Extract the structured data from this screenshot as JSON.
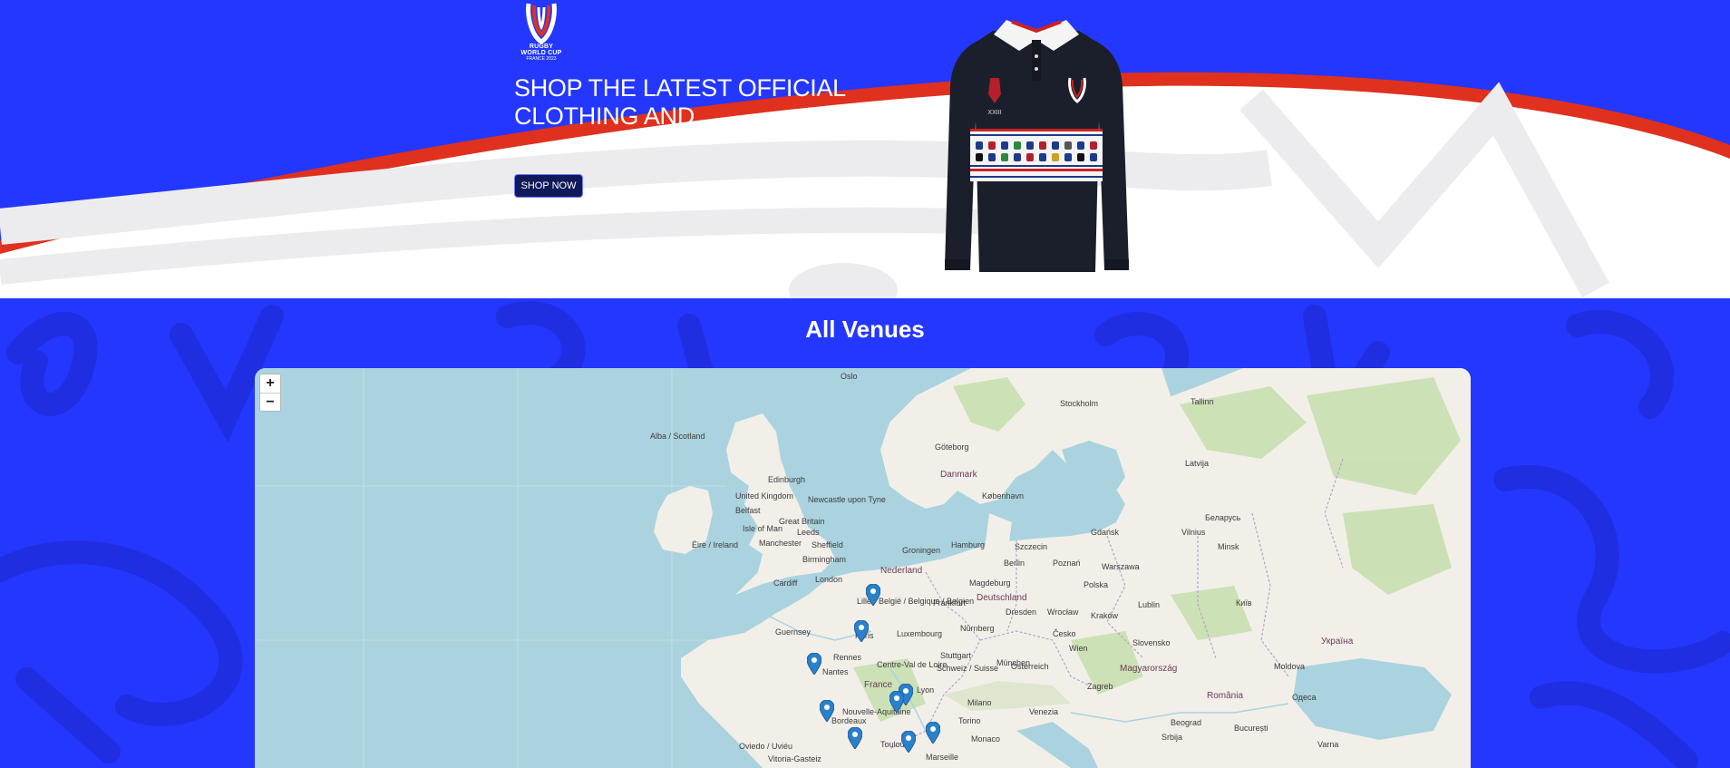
{
  "hero": {
    "logo": {
      "line1": "RUGBY",
      "line2": "WORLD CUP",
      "line3": "FRANCE 2023"
    },
    "title": "SHOP THE LATEST OFFICIAL CLOTHING AND MERCHANDISE",
    "button_label": "SHOP NOW",
    "shirt_crest_text": "XXIII"
  },
  "venues": {
    "title": "All Venues",
    "map": {
      "zoom_in_label": "+",
      "zoom_out_label": "−",
      "place_labels": [
        {
          "text": "Oslo",
          "cls": ""
        },
        {
          "text": "Stockholm",
          "cls": ""
        },
        {
          "text": "Tallinn",
          "cls": ""
        },
        {
          "text": "Alba / Scotland",
          "cls": ""
        },
        {
          "text": "Göteborg",
          "cls": ""
        },
        {
          "text": "Latvija",
          "cls": ""
        },
        {
          "text": "Danmark",
          "cls": "big"
        },
        {
          "text": "Edinburgh",
          "cls": ""
        },
        {
          "text": "United Kingdom",
          "cls": ""
        },
        {
          "text": "Newcastle upon Tyne",
          "cls": ""
        },
        {
          "text": "København",
          "cls": ""
        },
        {
          "text": "Belfast",
          "cls": ""
        },
        {
          "text": "Great Britain",
          "cls": ""
        },
        {
          "text": "Isle of Man",
          "cls": ""
        },
        {
          "text": "Leeds",
          "cls": ""
        },
        {
          "text": "Éire / Ireland",
          "cls": ""
        },
        {
          "text": "Manchester",
          "cls": ""
        },
        {
          "text": "Sheffield",
          "cls": ""
        },
        {
          "text": "Hamburg",
          "cls": ""
        },
        {
          "text": "Szczecin",
          "cls": ""
        },
        {
          "text": "Gdańsk",
          "cls": ""
        },
        {
          "text": "Vilnius",
          "cls": ""
        },
        {
          "text": "Birmingham",
          "cls": ""
        },
        {
          "text": "Groningen",
          "cls": ""
        },
        {
          "text": "Berlin",
          "cls": ""
        },
        {
          "text": "Poznań",
          "cls": ""
        },
        {
          "text": "Warszawa",
          "cls": ""
        },
        {
          "text": "Minsk",
          "cls": ""
        },
        {
          "text": "Беларусь",
          "cls": ""
        },
        {
          "text": "Cardiff",
          "cls": ""
        },
        {
          "text": "London",
          "cls": ""
        },
        {
          "text": "Nederland",
          "cls": "big"
        },
        {
          "text": "Magdeburg",
          "cls": ""
        },
        {
          "text": "Polska",
          "cls": ""
        },
        {
          "text": "Lille",
          "cls": ""
        },
        {
          "text": "België / Belgique / Belgien",
          "cls": ""
        },
        {
          "text": "Frankfurt",
          "cls": ""
        },
        {
          "text": "Deutschland",
          "cls": "big"
        },
        {
          "text": "Dresden",
          "cls": ""
        },
        {
          "text": "Wrocław",
          "cls": ""
        },
        {
          "text": "Kraków",
          "cls": ""
        },
        {
          "text": "Lublin",
          "cls": ""
        },
        {
          "text": "Київ",
          "cls": ""
        },
        {
          "text": "Guernsey",
          "cls": ""
        },
        {
          "text": "Paris",
          "cls": ""
        },
        {
          "text": "Luxembourg",
          "cls": ""
        },
        {
          "text": "Nürnberg",
          "cls": ""
        },
        {
          "text": "Česko",
          "cls": ""
        },
        {
          "text": "Slovensko",
          "cls": ""
        },
        {
          "text": "Україна",
          "cls": "big"
        },
        {
          "text": "Rennes",
          "cls": ""
        },
        {
          "text": "Stuttgart",
          "cls": ""
        },
        {
          "text": "München",
          "cls": ""
        },
        {
          "text": "Wien",
          "cls": ""
        },
        {
          "text": "Nantes",
          "cls": ""
        },
        {
          "text": "Centre-Val de Loire",
          "cls": ""
        },
        {
          "text": "Schweiz / Suisse",
          "cls": ""
        },
        {
          "text": "Österreich",
          "cls": ""
        },
        {
          "text": "Magyarország",
          "cls": "big"
        },
        {
          "text": "Moldova",
          "cls": ""
        },
        {
          "text": "France",
          "cls": "big"
        },
        {
          "text": "Lyon",
          "cls": ""
        },
        {
          "text": "Milano",
          "cls": ""
        },
        {
          "text": "Venezia",
          "cls": ""
        },
        {
          "text": "Zagreb",
          "cls": ""
        },
        {
          "text": "România",
          "cls": "big"
        },
        {
          "text": "Одеса",
          "cls": ""
        },
        {
          "text": "Nouvelle-Aquitaine",
          "cls": ""
        },
        {
          "text": "Bordeaux",
          "cls": ""
        },
        {
          "text": "Torino",
          "cls": ""
        },
        {
          "text": "Beograd",
          "cls": ""
        },
        {
          "text": "București",
          "cls": ""
        },
        {
          "text": "Toulouse",
          "cls": ""
        },
        {
          "text": "Marseille",
          "cls": ""
        },
        {
          "text": "Monaco",
          "cls": ""
        },
        {
          "text": "Srbija",
          "cls": ""
        },
        {
          "text": "Varna",
          "cls": ""
        },
        {
          "text": "Oviedo / Uviéu",
          "cls": ""
        },
        {
          "text": "Vitoria-Gasteiz",
          "cls": ""
        }
      ],
      "markers": [
        "Lille",
        "Paris",
        "Nantes",
        "Lyon",
        "Saint-Étienne",
        "Bordeaux",
        "Toulouse",
        "Marseille",
        "Nice"
      ]
    }
  },
  "colors": {
    "brand_blue": "#2437ff",
    "brand_red": "#e0301e",
    "sea": "#aad3df",
    "land": "#f2efe9",
    "forest": "#c8dfb0",
    "marker": "#2a81cb",
    "button_bg": "#101a5a"
  }
}
